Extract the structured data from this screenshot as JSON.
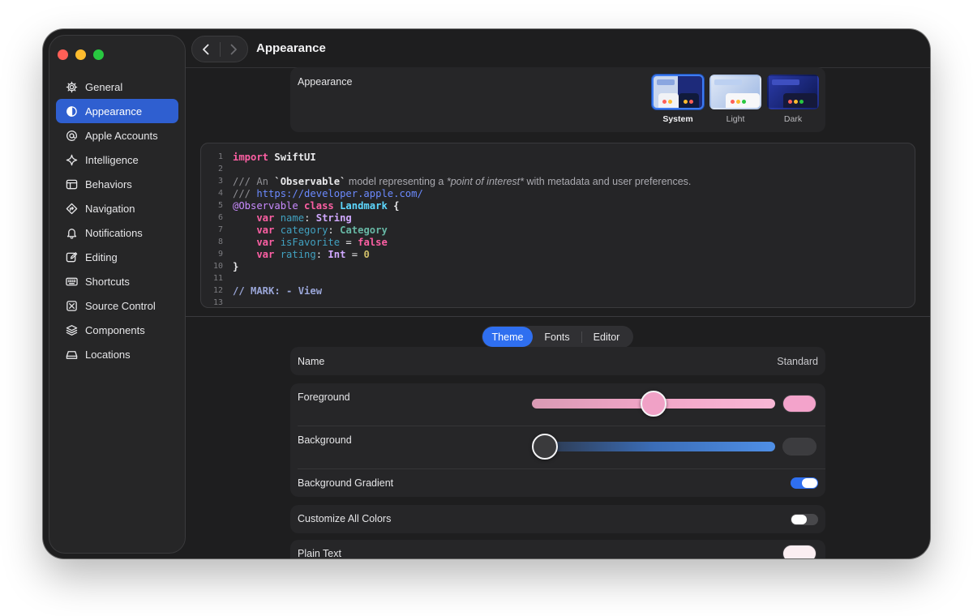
{
  "sidebar": {
    "items": [
      {
        "label": "General",
        "icon": "gear-icon"
      },
      {
        "label": "Appearance",
        "icon": "appearance-icon",
        "active": true
      },
      {
        "label": "Apple Accounts",
        "icon": "at-icon"
      },
      {
        "label": "Intelligence",
        "icon": "sparkle-icon"
      },
      {
        "label": "Behaviors",
        "icon": "behaviors-icon"
      },
      {
        "label": "Navigation",
        "icon": "navigation-icon"
      },
      {
        "label": "Notifications",
        "icon": "bell-icon"
      },
      {
        "label": "Editing",
        "icon": "edit-icon"
      },
      {
        "label": "Shortcuts",
        "icon": "keyboard-icon"
      },
      {
        "label": "Source Control",
        "icon": "source-control-icon"
      },
      {
        "label": "Components",
        "icon": "components-icon"
      },
      {
        "label": "Locations",
        "icon": "drive-icon"
      }
    ]
  },
  "header": {
    "title": "Appearance"
  },
  "appearance": {
    "label": "Appearance",
    "options": [
      {
        "caption": "System",
        "selected": true
      },
      {
        "caption": "Light",
        "selected": false
      },
      {
        "caption": "Dark",
        "selected": false
      }
    ]
  },
  "code": {
    "line_numbers": [
      "1",
      "2",
      "3",
      "4",
      "5",
      "6",
      "7",
      "8",
      "9",
      "10",
      "11",
      "12",
      "13"
    ],
    "lines": {
      "l1_kw": "import",
      "l1_mod": " SwiftUI",
      "l3_a": "/// An ",
      "l3_b": "`Observable`",
      "l3_c": " model representing a ",
      "l3_d": "*point of interest*",
      "l3_e": " with metadata and user preferences.",
      "l4_a": "/// ",
      "l4_b": "https://developer.apple.com/",
      "l5_a": "@Observable",
      "l5_b": " class",
      "l5_c": " Landmark",
      "l5_d": " {",
      "l6_a": "    var",
      "l6_b": " name",
      "l6_c": ":",
      "l6_d": " String",
      "l7_a": "    var",
      "l7_b": " category",
      "l7_c": ":",
      "l7_d": " Category",
      "l8_a": "    var",
      "l8_b": " isFavorite",
      "l8_c": " =",
      "l8_d": " false",
      "l9_a": "    var",
      "l9_b": " rating",
      "l9_c": ":",
      "l9_d": " Int",
      "l9_e": " =",
      "l9_f": " 0",
      "l10": "}",
      "l12": "// MARK: - View"
    }
  },
  "tabs": [
    "Theme",
    "Fonts",
    "Editor"
  ],
  "theme": {
    "name_label": "Name",
    "name_value": "Standard",
    "foreground_label": "Foreground",
    "foreground_slider": 0.5,
    "foreground_color": "#f3a3cb",
    "background_label": "Background",
    "background_slider": 0.0,
    "background_color": "#3c3c3f",
    "gradient_label": "Background Gradient",
    "gradient_on": true,
    "customize_label": "Customize All Colors",
    "customize_on": false,
    "plain_text_label": "Plain Text",
    "plain_text_color": "#fbeef2"
  }
}
